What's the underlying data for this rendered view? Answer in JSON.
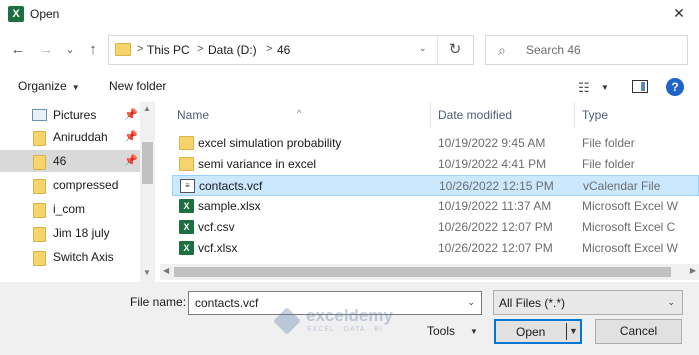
{
  "window": {
    "title": "Open",
    "app_icon_letter": "X",
    "close_glyph": "✕"
  },
  "nav": {
    "back_glyph": "←",
    "forward_glyph": "→",
    "recent_glyph": "⌄",
    "up_glyph": "↑",
    "refresh_glyph": "↻",
    "address": {
      "crumbs": [
        "This PC",
        "Data (D:)",
        "46"
      ],
      "separator": ">",
      "dropdown_glyph": "⌄"
    },
    "search": {
      "placeholder": "Search 46",
      "icon": "search-icon",
      "glyph": "⌕"
    }
  },
  "toolbar": {
    "organize_label": "Organize",
    "new_folder_label": "New folder",
    "dropdown_glyph": "▼",
    "view_glyph": "☷",
    "help_glyph": "?"
  },
  "sidebar": {
    "pin_glyph": "📌",
    "items": [
      {
        "label": "Pictures",
        "icon": "pictures-icon",
        "pinned": true,
        "selected": false
      },
      {
        "label": "Aniruddah",
        "icon": "folder-icon",
        "pinned": true,
        "selected": false
      },
      {
        "label": "46",
        "icon": "folder-icon",
        "pinned": true,
        "selected": true
      },
      {
        "label": "compressed",
        "icon": "folder-icon",
        "pinned": false,
        "selected": false
      },
      {
        "label": "i_com",
        "icon": "folder-icon",
        "pinned": false,
        "selected": false
      },
      {
        "label": "Jim 18 july",
        "icon": "folder-icon",
        "pinned": false,
        "selected": false
      },
      {
        "label": "Switch Axis",
        "icon": "folder-icon",
        "pinned": false,
        "selected": false
      }
    ]
  },
  "files": {
    "columns": [
      "Name",
      "Date modified",
      "Type"
    ],
    "sort_glyph": "^",
    "rows": [
      {
        "name": "excel simulation probability",
        "date": "10/19/2022 9:45 AM",
        "type": "File folder",
        "icon": "folder-icon",
        "selected": false
      },
      {
        "name": "semi variance in excel",
        "date": "10/19/2022 4:41 PM",
        "type": "File folder",
        "icon": "folder-icon",
        "selected": false
      },
      {
        "name": "contacts.vcf",
        "date": "10/26/2022 12:15 PM",
        "type": "vCalendar File",
        "icon": "vcf-icon",
        "selected": true
      },
      {
        "name": "sample.xlsx",
        "date": "10/19/2022 11:37 AM",
        "type": "Microsoft Excel W",
        "icon": "excel-icon",
        "selected": false
      },
      {
        "name": "vcf.csv",
        "date": "10/26/2022 12:07 PM",
        "type": "Microsoft Excel C",
        "icon": "excel-icon",
        "selected": false
      },
      {
        "name": "vcf.xlsx",
        "date": "10/26/2022 12:07 PM",
        "type": "Microsoft Excel W",
        "icon": "excel-icon",
        "selected": false
      }
    ]
  },
  "footer": {
    "file_name_label": "File name:",
    "file_name_value": "contacts.vcf",
    "filter_value": "All Files (*.*)",
    "tools_label": "Tools",
    "open_label": "Open",
    "cancel_label": "Cancel",
    "dropdown_glyph": "⌄"
  },
  "watermark": {
    "name": "exceldemy",
    "tagline": "EXCEL · DATA · BI"
  },
  "colors": {
    "accent": "#0078d7",
    "selection_bg": "#cce8ff",
    "excel_green": "#1d6f42",
    "folder_yellow": "#f7d36b"
  }
}
